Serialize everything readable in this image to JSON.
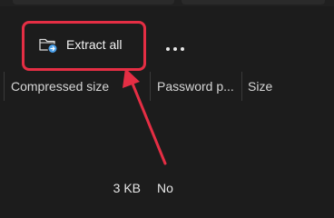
{
  "toolbar": {
    "extract_all_label": "Extract all",
    "more_label": "See more"
  },
  "columns": [
    {
      "label": "Compressed size"
    },
    {
      "label": "Password p..."
    },
    {
      "label": "Size"
    }
  ],
  "file_row": {
    "compressed_size": "3 KB",
    "password_protected": "No"
  },
  "annotation": {
    "highlight_color": "#e52e44",
    "icon_accent": "#4a9fe8"
  }
}
